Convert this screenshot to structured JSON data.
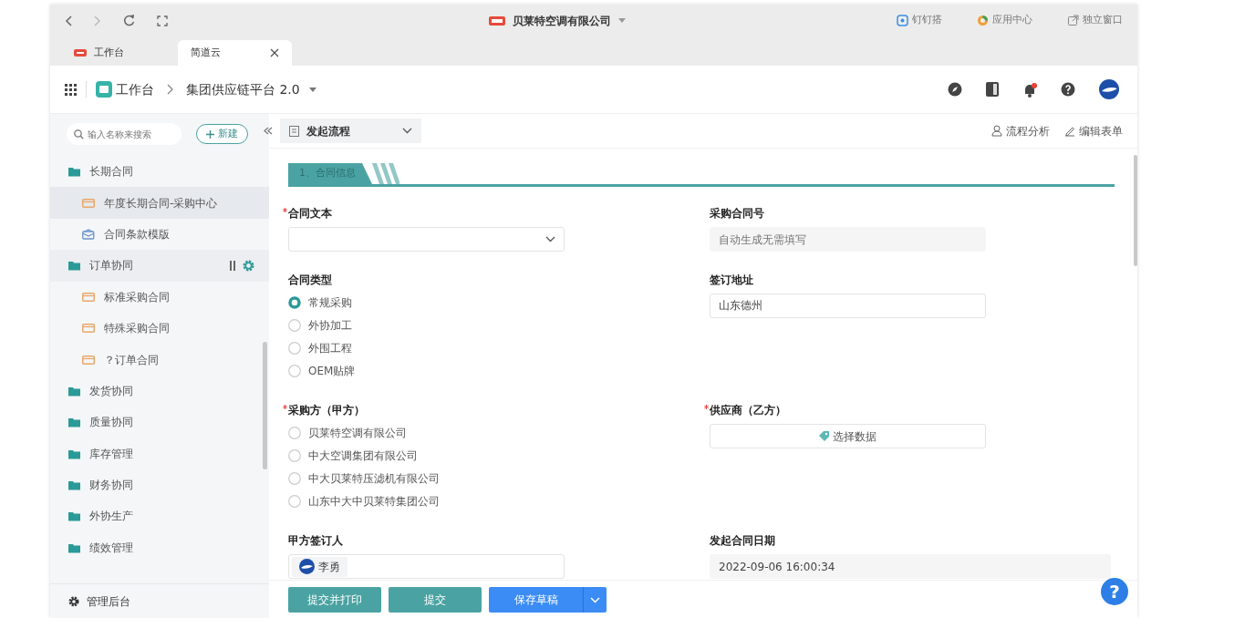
{
  "browser": {
    "company": "贝莱特空调有限公司",
    "links": [
      {
        "label": "钉钉搭",
        "kind": "dingtalk"
      },
      {
        "label": "应用中心",
        "kind": "apps"
      },
      {
        "label": "独立窗口",
        "kind": "window"
      }
    ],
    "tabs": [
      {
        "label": "工作台",
        "selected": false,
        "closable": false
      },
      {
        "label": "简道云",
        "selected": true,
        "closable": true
      }
    ]
  },
  "header": {
    "breadcrumb": [
      "工作台",
      "集团供应链平台 2.0"
    ],
    "notification": true
  },
  "sidebar": {
    "search": {
      "placeholder": "输入名称来搜索"
    },
    "new_button": "新建",
    "items": [
      {
        "label": "长期合同",
        "kind": "folder",
        "selected": false,
        "hovered": false,
        "children": [
          {
            "label": "年度长期合同-采购中心",
            "kind": "form",
            "selected": true,
            "hovered": false
          },
          {
            "label": "合同条款模版",
            "kind": "report",
            "selected": false,
            "hovered": false
          }
        ]
      },
      {
        "label": "订单协同",
        "kind": "folder",
        "selected": false,
        "hovered": true,
        "children": [
          {
            "label": "标准采购合同",
            "kind": "form",
            "selected": false,
            "hovered": false
          },
          {
            "label": "特殊采购合同",
            "kind": "form",
            "selected": false,
            "hovered": false
          },
          {
            "label": "？订单合同",
            "kind": "form",
            "selected": false,
            "hovered": false
          }
        ]
      },
      {
        "label": "发货协同",
        "kind": "folder",
        "selected": false,
        "hovered": false
      },
      {
        "label": "质量协同",
        "kind": "folder",
        "selected": false,
        "hovered": false
      },
      {
        "label": "库存管理",
        "kind": "folder",
        "selected": false,
        "hovered": false
      },
      {
        "label": "财务协同",
        "kind": "folder",
        "selected": false,
        "hovered": false
      },
      {
        "label": "外协生产",
        "kind": "folder",
        "selected": false,
        "hovered": false
      },
      {
        "label": "绩效管理",
        "kind": "folder",
        "selected": false,
        "hovered": false
      }
    ],
    "footer": "管理后台"
  },
  "toolbar": {
    "process_button": "发起流程",
    "actions": [
      {
        "label": "流程分析",
        "kind": "analysis"
      },
      {
        "label": "编辑表单",
        "kind": "edit"
      }
    ]
  },
  "form": {
    "section": "1、合同信息",
    "rows": [
      [
        {
          "label": "合同文本",
          "required": true,
          "kind": "select"
        },
        {
          "label": "采购合同号",
          "required": false,
          "kind": "text",
          "disabled": true,
          "placeholder": "自动生成无需填写"
        }
      ],
      [
        {
          "label": "合同类型",
          "required": false,
          "kind": "radio",
          "options": [
            {
              "label": "常规采购",
              "selected": true
            },
            {
              "label": "外协加工",
              "selected": false
            },
            {
              "label": "外围工程",
              "selected": false
            },
            {
              "label": "OEM贴牌",
              "selected": false
            }
          ]
        },
        {
          "label": "签订地址",
          "required": false,
          "kind": "text",
          "disabled": false,
          "value": "山东德州"
        }
      ],
      [
        {
          "label": "采购方（甲方）",
          "required": true,
          "kind": "radio",
          "options": [
            {
              "label": "贝莱特空调有限公司",
              "selected": false
            },
            {
              "label": "中大空调集团有限公司",
              "selected": false
            },
            {
              "label": "中大贝莱特压滤机有限公司",
              "selected": false
            },
            {
              "label": "山东中大中贝莱特集团公司",
              "selected": false
            }
          ]
        },
        {
          "label": "供应商（乙方）",
          "required": true,
          "kind": "picker",
          "button": "选择数据"
        }
      ],
      [
        {
          "label": "甲方签订人",
          "required": false,
          "kind": "user",
          "value": "李勇"
        },
        {
          "label": "发起合同日期",
          "required": false,
          "kind": "text",
          "disabled": true,
          "value": "2022-09-06 16:00:34",
          "wide": true
        }
      ]
    ]
  },
  "footer_buttons": [
    {
      "label": "提交并打印",
      "kind": "teal",
      "split": false
    },
    {
      "label": "提交",
      "kind": "teal",
      "split": false
    },
    {
      "label": "保存草稿",
      "kind": "primary",
      "split": true
    }
  ],
  "help_button": "?"
}
